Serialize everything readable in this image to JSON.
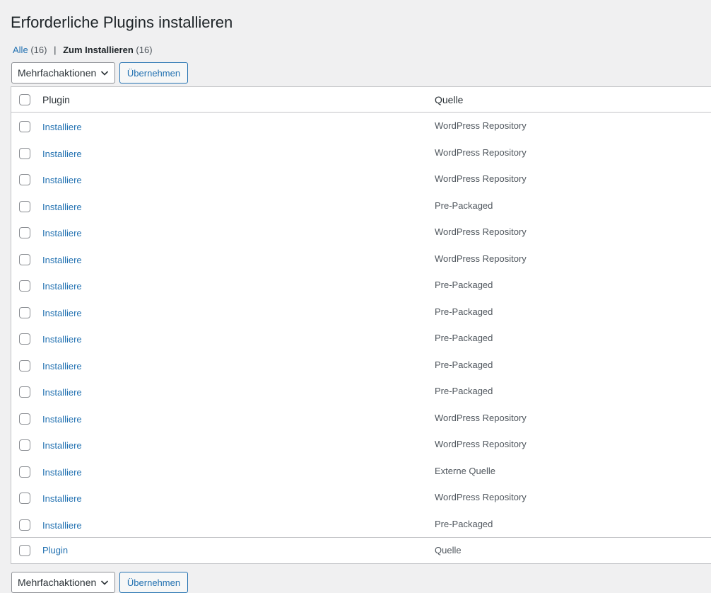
{
  "page": {
    "title": "Erforderliche Plugins installieren"
  },
  "filters": {
    "all_label": "Alle",
    "all_count": "(16)",
    "separator": "|",
    "install_label": "Zum Installieren",
    "install_count": "(16)"
  },
  "bulk": {
    "select_value": "Mehrfachaktionen",
    "apply_label": "Übernehmen"
  },
  "table": {
    "headers": {
      "plugin": "Plugin",
      "source": "Quelle"
    },
    "footers": {
      "plugin": "Plugin",
      "source": "Quelle"
    },
    "rows": [
      {
        "action": "Installiere",
        "source": "WordPress Repository"
      },
      {
        "action": "Installiere",
        "source": "WordPress Repository"
      },
      {
        "action": "Installiere",
        "source": "WordPress Repository"
      },
      {
        "action": "Installiere",
        "source": "Pre-Packaged"
      },
      {
        "action": "Installiere",
        "source": "WordPress Repository"
      },
      {
        "action": "Installiere",
        "source": "WordPress Repository"
      },
      {
        "action": "Installiere",
        "source": "Pre-Packaged"
      },
      {
        "action": "Installiere",
        "source": "Pre-Packaged"
      },
      {
        "action": "Installiere",
        "source": "Pre-Packaged"
      },
      {
        "action": "Installiere",
        "source": "Pre-Packaged"
      },
      {
        "action": "Installiere",
        "source": "Pre-Packaged"
      },
      {
        "action": "Installiere",
        "source": "WordPress Repository"
      },
      {
        "action": "Installiere",
        "source": "WordPress Repository"
      },
      {
        "action": "Installiere",
        "source": "Externe Quelle"
      },
      {
        "action": "Installiere",
        "source": "WordPress Repository"
      },
      {
        "action": "Installiere",
        "source": "Pre-Packaged"
      }
    ]
  },
  "icons": {
    "select_chevron": "chevron-down-icon"
  }
}
